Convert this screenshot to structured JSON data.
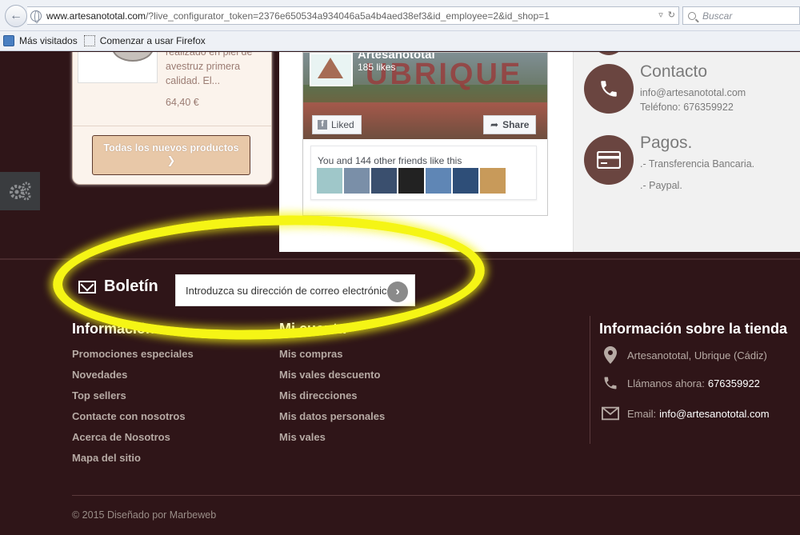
{
  "browser": {
    "url_host": "www.artesanototal.com",
    "url_rest": "/?live_configurator_token=2376e650534a934046a5a4b4aed38ef3&id_employee=2&id_shop=1",
    "search_placeholder": "Buscar",
    "bookmarks": [
      "Más visitados",
      "Comenzar a usar Firefox"
    ]
  },
  "product": {
    "description": "realizado en piel de avestruz primera calidad. El...",
    "price": "64,40 €",
    "all_new_button": "Todas los nuevos productos"
  },
  "facebook": {
    "page_name": "Artesanototal",
    "likes": "185 likes",
    "liked_label": "Liked",
    "share_label": "Share",
    "friends_text": "You and 144 other friends like this",
    "avatar_colors": [
      "#9fc7c9",
      "#7a8fa8",
      "#3a4f6e",
      "#222222",
      "#5f86b5",
      "#2e4e78",
      "#c89a5a"
    ]
  },
  "contact": {
    "title": "Contacto",
    "email": "info@artesanototal.com",
    "phone": "Teléfono: 676359922"
  },
  "payments": {
    "title": "Pagos.",
    "lines": [
      ".- Transferencia Bancaria.",
      ".- Paypal."
    ]
  },
  "newsletter": {
    "title": "Boletín",
    "input_placeholder": "Introduzca su dirección de correo electrónico"
  },
  "footer": {
    "info_title": "Información",
    "info_links": [
      "Promociones especiales",
      "Novedades",
      "Top sellers",
      "Contacte con nosotros",
      "Acerca de Nosotros",
      "Mapa del sitio"
    ],
    "account_title": "Mi cuenta",
    "account_links": [
      "Mis compras",
      "Mis vales descuento",
      "Mis direcciones",
      "Mis datos personales",
      "Mis vales"
    ],
    "store_title": "Información sobre la tienda",
    "store_address": "Artesanototal, Ubrique (Cádiz)",
    "store_call_label": "Llámanos ahora:",
    "store_call_value": "676359922",
    "store_email_label": "Email:",
    "store_email_value": "info@artesanototal.com",
    "copyright": "© 2015 Diseñado por Marbeweb"
  },
  "colors": {
    "footer_bg": "#2f1518",
    "accent_brown": "#6a4540",
    "highlight": "#f5f515",
    "button_bg": "#e8c8a8"
  }
}
